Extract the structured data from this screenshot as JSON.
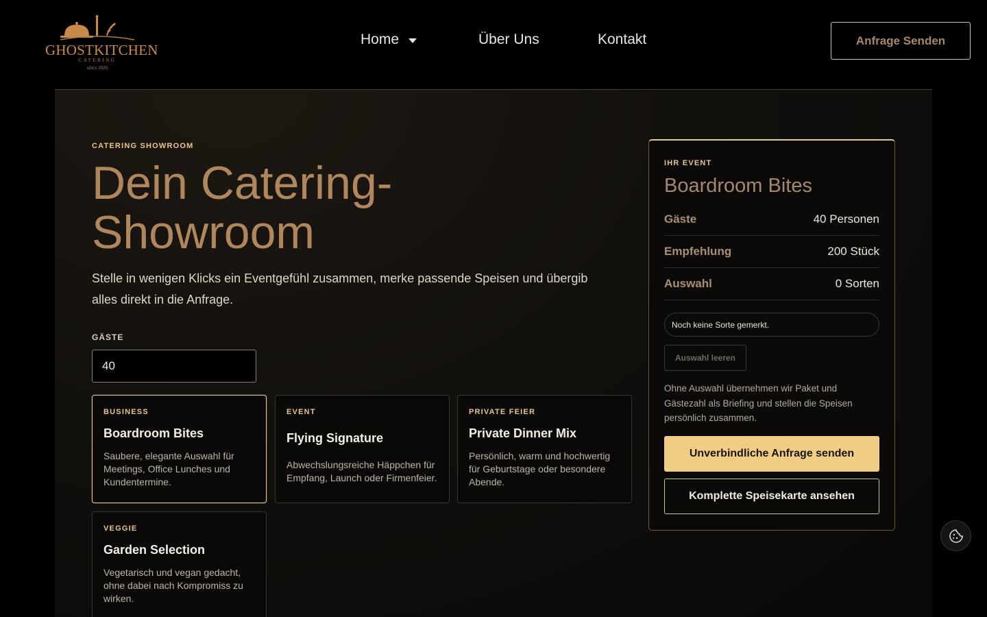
{
  "brand": {
    "name": "GHOSTKITCHEN",
    "subtitle": "CATERING",
    "since": "since 2026",
    "logo_icon": "cloche-wheat-logo-icon",
    "accent_color": "#c8894a"
  },
  "nav": {
    "items": [
      {
        "label": "Home",
        "has_dropdown": true
      },
      {
        "label": "Über Uns"
      },
      {
        "label": "Kontakt"
      }
    ],
    "cta_label": "Anfrage Senden"
  },
  "hero": {
    "eyebrow": "CATERING SHOWROOM",
    "title_line1": "Dein Catering-",
    "title_line2": "Showroom",
    "description": "Stelle in wenigen Klicks ein Eventgefühl zusammen, merke passende Speisen und übergib alles direkt in die Anfrage.",
    "title_color": "#b0875d"
  },
  "guests": {
    "label": "GÄSTE",
    "value": "40"
  },
  "packages": [
    {
      "tag": "BUSINESS",
      "title": "Boardroom Bites",
      "description": "Saubere, elegante Auswahl für Meetings, Office Lunches und Kundentermine.",
      "selected": true
    },
    {
      "tag": "EVENT",
      "title": "Flying Signature",
      "description": "Abwechslungsreiche Häppchen für Empfang, Launch oder Firmenfeier.",
      "selected": false
    },
    {
      "tag": "PRIVATE FEIER",
      "title": "Private Dinner Mix",
      "description": "Persönlich, warm und hochwertig für Geburtstage oder besondere Abende.",
      "selected": false
    },
    {
      "tag": "VEGGIE",
      "title": "Garden Selection",
      "description": "Vegetarisch und vegan gedacht, ohne dabei nach Kompromiss zu wirken.",
      "selected": false
    }
  ],
  "summary": {
    "eyebrow": "IHR EVENT",
    "title": "Boardroom Bites",
    "rows": [
      {
        "label": "Gäste",
        "value": "40 Personen"
      },
      {
        "label": "Empfehlung",
        "value": "200 Stück"
      },
      {
        "label": "Auswahl",
        "value": "0 Sorten"
      }
    ],
    "empty_selection": "Noch keine Sorte gemerkt.",
    "clear_label": "Auswahl leeren",
    "note": "Ohne Auswahl übernehmen wir Paket und Gästezahl als Briefing und stellen die Speisen persönlich zusammen.",
    "primary_label": "Unverbindliche Anfrage senden",
    "secondary_label": "Komplette Speisekarte ansehen",
    "primary_color": "#f0cd85"
  },
  "cookie": {
    "icon": "cookie-settings-icon"
  }
}
